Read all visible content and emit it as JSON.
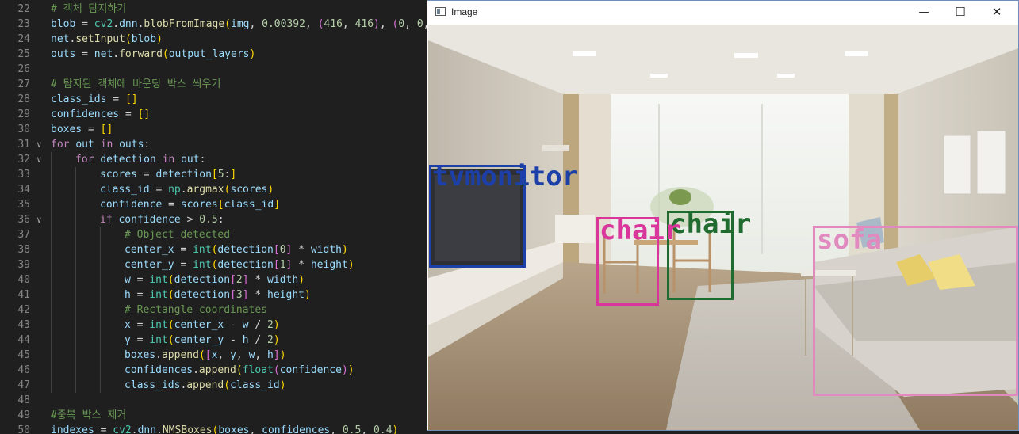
{
  "editor": {
    "lines": [
      {
        "n": "22",
        "fold": "",
        "indent": 0,
        "tokens": [
          [
            "cm",
            "# 객체 탐지하기"
          ]
        ]
      },
      {
        "n": "23",
        "fold": "",
        "indent": 0,
        "tokens": [
          [
            "vr",
            "blob"
          ],
          [
            "pl",
            " = "
          ],
          [
            "bi",
            "cv2"
          ],
          [
            "pl",
            "."
          ],
          [
            "vr",
            "dnn"
          ],
          [
            "pl",
            "."
          ],
          [
            "fn",
            "blobFromImage"
          ],
          [
            "br1",
            "("
          ],
          [
            "vr",
            "img"
          ],
          [
            "pl",
            ", "
          ],
          [
            "nm",
            "0.00392"
          ],
          [
            "pl",
            ", "
          ],
          [
            "br2",
            "("
          ],
          [
            "nm",
            "416"
          ],
          [
            "pl",
            ", "
          ],
          [
            "nm",
            "416"
          ],
          [
            "br2",
            ")"
          ],
          [
            "pl",
            ", "
          ],
          [
            "br2",
            "("
          ],
          [
            "nm",
            "0"
          ],
          [
            "pl",
            ", "
          ],
          [
            "nm",
            "0"
          ],
          [
            "pl",
            ","
          ]
        ]
      },
      {
        "n": "24",
        "fold": "",
        "indent": 0,
        "tokens": [
          [
            "vr",
            "net"
          ],
          [
            "pl",
            "."
          ],
          [
            "fn",
            "setInput"
          ],
          [
            "br1",
            "("
          ],
          [
            "vr",
            "blob"
          ],
          [
            "br1",
            ")"
          ]
        ]
      },
      {
        "n": "25",
        "fold": "",
        "indent": 0,
        "tokens": [
          [
            "vr",
            "outs"
          ],
          [
            "pl",
            " = "
          ],
          [
            "vr",
            "net"
          ],
          [
            "pl",
            "."
          ],
          [
            "fn",
            "forward"
          ],
          [
            "br1",
            "("
          ],
          [
            "vr",
            "output_layers"
          ],
          [
            "br1",
            ")"
          ]
        ]
      },
      {
        "n": "26",
        "fold": "",
        "indent": 0,
        "tokens": []
      },
      {
        "n": "27",
        "fold": "",
        "indent": 0,
        "tokens": [
          [
            "cm",
            "# 탐지된 객체에 바운딩 박스 씌우기"
          ]
        ]
      },
      {
        "n": "28",
        "fold": "",
        "indent": 0,
        "tokens": [
          [
            "vr",
            "class_ids"
          ],
          [
            "pl",
            " = "
          ],
          [
            "br1",
            "[]"
          ]
        ]
      },
      {
        "n": "29",
        "fold": "",
        "indent": 0,
        "tokens": [
          [
            "vr",
            "confidences"
          ],
          [
            "pl",
            " = "
          ],
          [
            "br1",
            "[]"
          ]
        ]
      },
      {
        "n": "30",
        "fold": "",
        "indent": 0,
        "tokens": [
          [
            "vr",
            "boxes"
          ],
          [
            "pl",
            " = "
          ],
          [
            "br1",
            "[]"
          ]
        ]
      },
      {
        "n": "31",
        "fold": "v",
        "indent": 0,
        "tokens": [
          [
            "kw",
            "for"
          ],
          [
            "pl",
            " "
          ],
          [
            "vr",
            "out"
          ],
          [
            "pl",
            " "
          ],
          [
            "kw",
            "in"
          ],
          [
            "pl",
            " "
          ],
          [
            "vr",
            "outs"
          ],
          [
            "pl",
            ":"
          ]
        ]
      },
      {
        "n": "32",
        "fold": "v",
        "indent": 1,
        "tokens": [
          [
            "kw",
            "for"
          ],
          [
            "pl",
            " "
          ],
          [
            "vr",
            "detection"
          ],
          [
            "pl",
            " "
          ],
          [
            "kw",
            "in"
          ],
          [
            "pl",
            " "
          ],
          [
            "vr",
            "out"
          ],
          [
            "pl",
            ":"
          ]
        ]
      },
      {
        "n": "33",
        "fold": "",
        "indent": 2,
        "tokens": [
          [
            "vr",
            "scores"
          ],
          [
            "pl",
            " = "
          ],
          [
            "vr",
            "detection"
          ],
          [
            "br1",
            "["
          ],
          [
            "nm",
            "5"
          ],
          [
            "pl",
            ":"
          ],
          [
            "br1",
            "]"
          ]
        ]
      },
      {
        "n": "34",
        "fold": "",
        "indent": 2,
        "tokens": [
          [
            "vr",
            "class_id"
          ],
          [
            "pl",
            " = "
          ],
          [
            "bi",
            "np"
          ],
          [
            "pl",
            "."
          ],
          [
            "fn",
            "argmax"
          ],
          [
            "br1",
            "("
          ],
          [
            "vr",
            "scores"
          ],
          [
            "br1",
            ")"
          ]
        ]
      },
      {
        "n": "35",
        "fold": "",
        "indent": 2,
        "tokens": [
          [
            "vr",
            "confidence"
          ],
          [
            "pl",
            " = "
          ],
          [
            "vr",
            "scores"
          ],
          [
            "br1",
            "["
          ],
          [
            "vr",
            "class_id"
          ],
          [
            "br1",
            "]"
          ]
        ]
      },
      {
        "n": "36",
        "fold": "v",
        "indent": 2,
        "tokens": [
          [
            "kw",
            "if"
          ],
          [
            "pl",
            " "
          ],
          [
            "vr",
            "confidence"
          ],
          [
            "pl",
            " > "
          ],
          [
            "nm",
            "0.5"
          ],
          [
            "pl",
            ":"
          ]
        ]
      },
      {
        "n": "37",
        "fold": "",
        "indent": 3,
        "tokens": [
          [
            "cm",
            "# Object detected"
          ]
        ]
      },
      {
        "n": "38",
        "fold": "",
        "indent": 3,
        "tokens": [
          [
            "vr",
            "center_x"
          ],
          [
            "pl",
            " = "
          ],
          [
            "bi",
            "int"
          ],
          [
            "br1",
            "("
          ],
          [
            "vr",
            "detection"
          ],
          [
            "br2",
            "["
          ],
          [
            "nm",
            "0"
          ],
          [
            "br2",
            "]"
          ],
          [
            "pl",
            " * "
          ],
          [
            "vr",
            "width"
          ],
          [
            "br1",
            ")"
          ]
        ]
      },
      {
        "n": "39",
        "fold": "",
        "indent": 3,
        "tokens": [
          [
            "vr",
            "center_y"
          ],
          [
            "pl",
            " = "
          ],
          [
            "bi",
            "int"
          ],
          [
            "br1",
            "("
          ],
          [
            "vr",
            "detection"
          ],
          [
            "br2",
            "["
          ],
          [
            "nm",
            "1"
          ],
          [
            "br2",
            "]"
          ],
          [
            "pl",
            " * "
          ],
          [
            "vr",
            "height"
          ],
          [
            "br1",
            ")"
          ]
        ]
      },
      {
        "n": "40",
        "fold": "",
        "indent": 3,
        "tokens": [
          [
            "vr",
            "w"
          ],
          [
            "pl",
            " = "
          ],
          [
            "bi",
            "int"
          ],
          [
            "br1",
            "("
          ],
          [
            "vr",
            "detection"
          ],
          [
            "br2",
            "["
          ],
          [
            "nm",
            "2"
          ],
          [
            "br2",
            "]"
          ],
          [
            "pl",
            " * "
          ],
          [
            "vr",
            "width"
          ],
          [
            "br1",
            ")"
          ]
        ]
      },
      {
        "n": "41",
        "fold": "",
        "indent": 3,
        "tokens": [
          [
            "vr",
            "h"
          ],
          [
            "pl",
            " = "
          ],
          [
            "bi",
            "int"
          ],
          [
            "br1",
            "("
          ],
          [
            "vr",
            "detection"
          ],
          [
            "br2",
            "["
          ],
          [
            "nm",
            "3"
          ],
          [
            "br2",
            "]"
          ],
          [
            "pl",
            " * "
          ],
          [
            "vr",
            "height"
          ],
          [
            "br1",
            ")"
          ]
        ]
      },
      {
        "n": "42",
        "fold": "",
        "indent": 3,
        "tokens": [
          [
            "cm",
            "# Rectangle coordinates"
          ]
        ]
      },
      {
        "n": "43",
        "fold": "",
        "indent": 3,
        "tokens": [
          [
            "vr",
            "x"
          ],
          [
            "pl",
            " = "
          ],
          [
            "bi",
            "int"
          ],
          [
            "br1",
            "("
          ],
          [
            "vr",
            "center_x"
          ],
          [
            "pl",
            " - "
          ],
          [
            "vr",
            "w"
          ],
          [
            "pl",
            " / "
          ],
          [
            "nm",
            "2"
          ],
          [
            "br1",
            ")"
          ]
        ]
      },
      {
        "n": "44",
        "fold": "",
        "indent": 3,
        "tokens": [
          [
            "vr",
            "y"
          ],
          [
            "pl",
            " = "
          ],
          [
            "bi",
            "int"
          ],
          [
            "br1",
            "("
          ],
          [
            "vr",
            "center_y"
          ],
          [
            "pl",
            " - "
          ],
          [
            "vr",
            "h"
          ],
          [
            "pl",
            " / "
          ],
          [
            "nm",
            "2"
          ],
          [
            "br1",
            ")"
          ]
        ]
      },
      {
        "n": "45",
        "fold": "",
        "indent": 3,
        "tokens": [
          [
            "vr",
            "boxes"
          ],
          [
            "pl",
            "."
          ],
          [
            "fn",
            "append"
          ],
          [
            "br1",
            "("
          ],
          [
            "br2",
            "["
          ],
          [
            "vr",
            "x"
          ],
          [
            "pl",
            ", "
          ],
          [
            "vr",
            "y"
          ],
          [
            "pl",
            ", "
          ],
          [
            "vr",
            "w"
          ],
          [
            "pl",
            ", "
          ],
          [
            "vr",
            "h"
          ],
          [
            "br2",
            "]"
          ],
          [
            "br1",
            ")"
          ]
        ]
      },
      {
        "n": "46",
        "fold": "",
        "indent": 3,
        "tokens": [
          [
            "vr",
            "confidences"
          ],
          [
            "pl",
            "."
          ],
          [
            "fn",
            "append"
          ],
          [
            "br1",
            "("
          ],
          [
            "bi",
            "float"
          ],
          [
            "br2",
            "("
          ],
          [
            "vr",
            "confidence"
          ],
          [
            "br2",
            ")"
          ],
          [
            "br1",
            ")"
          ]
        ]
      },
      {
        "n": "47",
        "fold": "",
        "indent": 3,
        "tokens": [
          [
            "vr",
            "class_ids"
          ],
          [
            "pl",
            "."
          ],
          [
            "fn",
            "append"
          ],
          [
            "br1",
            "("
          ],
          [
            "vr",
            "class_id"
          ],
          [
            "br1",
            ")"
          ]
        ]
      },
      {
        "n": "48",
        "fold": "",
        "indent": 0,
        "tokens": []
      },
      {
        "n": "49",
        "fold": "",
        "indent": 0,
        "tokens": [
          [
            "cm",
            "#중복 박스 제거"
          ]
        ]
      },
      {
        "n": "50",
        "fold": "",
        "indent": 0,
        "tokens": [
          [
            "vr",
            "indexes"
          ],
          [
            "pl",
            " = "
          ],
          [
            "bi",
            "cv2"
          ],
          [
            "pl",
            "."
          ],
          [
            "vr",
            "dnn"
          ],
          [
            "pl",
            "."
          ],
          [
            "fn",
            "NMSBoxes"
          ],
          [
            "br1",
            "("
          ],
          [
            "vr",
            "boxes"
          ],
          [
            "pl",
            ", "
          ],
          [
            "vr",
            "confidences"
          ],
          [
            "pl",
            ", "
          ],
          [
            "nm",
            "0.5"
          ],
          [
            "pl",
            ", "
          ],
          [
            "nm",
            "0.4"
          ],
          [
            "br1",
            ")"
          ]
        ]
      }
    ]
  },
  "window": {
    "title": "Image",
    "icon": "window-app-icon",
    "minimize_label": "—",
    "maximize_label": "☐",
    "close_label": "✕"
  },
  "detections": [
    {
      "label": "tvmonitor",
      "color": "#1c3fa8"
    },
    {
      "label": "chair",
      "color": "#d9359a"
    },
    {
      "label": "chair",
      "color": "#1f6b30"
    },
    {
      "label": "sofa",
      "color": "#e08ac0"
    }
  ]
}
